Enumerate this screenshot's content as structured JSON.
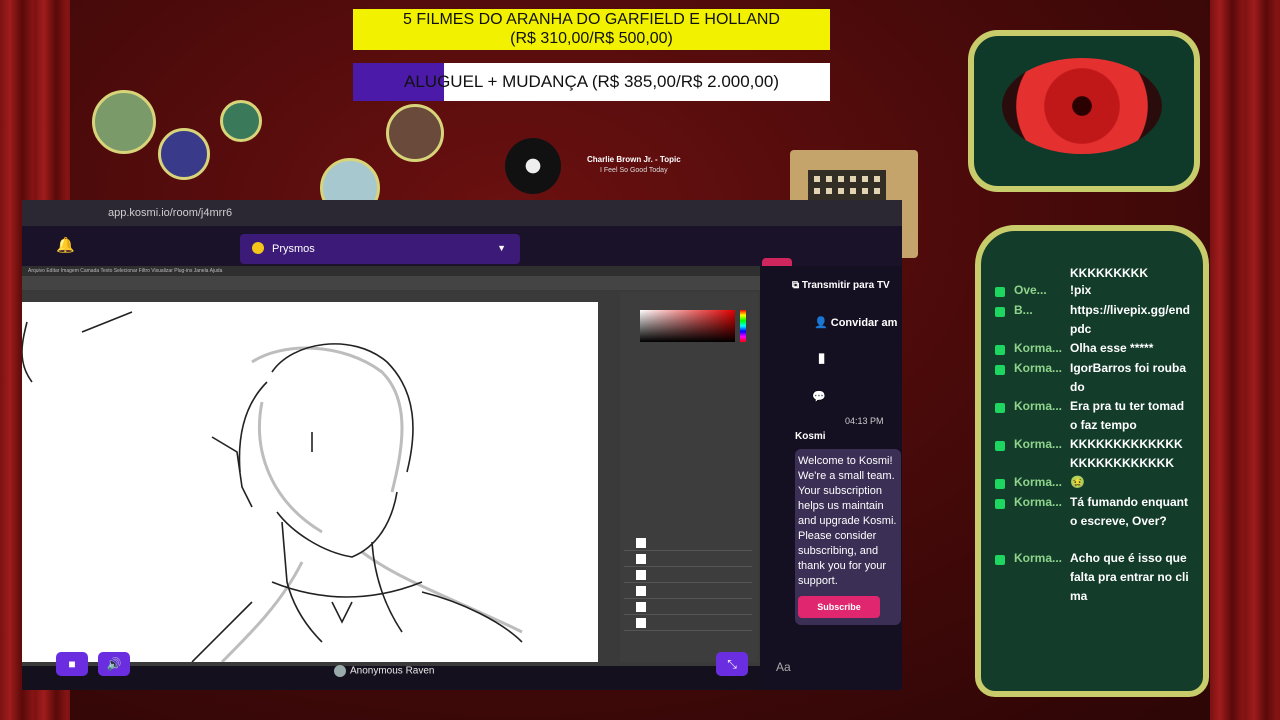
{
  "overlay": {
    "goal1_line1": "5 FILMES DO ARANHA DO GARFIELD E HOLLAND",
    "goal1_line2": "(R$ 310,00/R$ 500,00)",
    "goal2_text": "ALUGUEL + MUDANÇA (R$ 385,00/R$ 2.000,00)",
    "goal1_progress": 0.62,
    "goal2_progress": 0.19,
    "music_artist": "Charlie Brown Jr. - Topic",
    "music_track": "I Feel So Good Today"
  },
  "browser": {
    "url": "app.kosmi.io/room/j4mrr6",
    "room_name": "Prysmos",
    "viewer_name": "Anonymous Raven"
  },
  "kosmi": {
    "broadcast_label": "Transmitir para TV",
    "invite_label": "Convidar am",
    "time": "04:13 PM",
    "sender": "Kosmi",
    "welcome_message": "Welcome to Kosmi! We're a small team. Your subscription helps us maintain and upgrade Kosmi. Please consider subscribing, and thank you for your support.",
    "subscribe_label": "Subscribe",
    "input_placeholder": "Aa"
  },
  "chat": [
    {
      "user": "",
      "text": "KKKKKKKKK"
    },
    {
      "user": "Ove...",
      "text": "!pix"
    },
    {
      "user": "B...",
      "text": "https://livepix.gg/endpdc"
    },
    {
      "user": "Korma...",
      "text": "Olha esse *****"
    },
    {
      "user": "Korma...",
      "text": "IgorBarros foi roubado"
    },
    {
      "user": "Korma...",
      "text": "Era pra tu ter tomado faz tempo"
    },
    {
      "user": "Korma...",
      "text": "KKKKKKKKKKKKKKKKKKKKKKKKK"
    },
    {
      "user": "Korma...",
      "text": "🤢"
    },
    {
      "user": "Korma...",
      "text": "Tá fumando enquanto escreve, Over?"
    },
    {
      "user": "Korma...",
      "text": "Acho que é isso que falta pra entrar no clima"
    }
  ],
  "colors": {
    "accent": "#6a2ee0",
    "goal_yellow": "#f2f200",
    "chat_user": "#8fd48a",
    "frame_gold": "#c9cc6a"
  }
}
